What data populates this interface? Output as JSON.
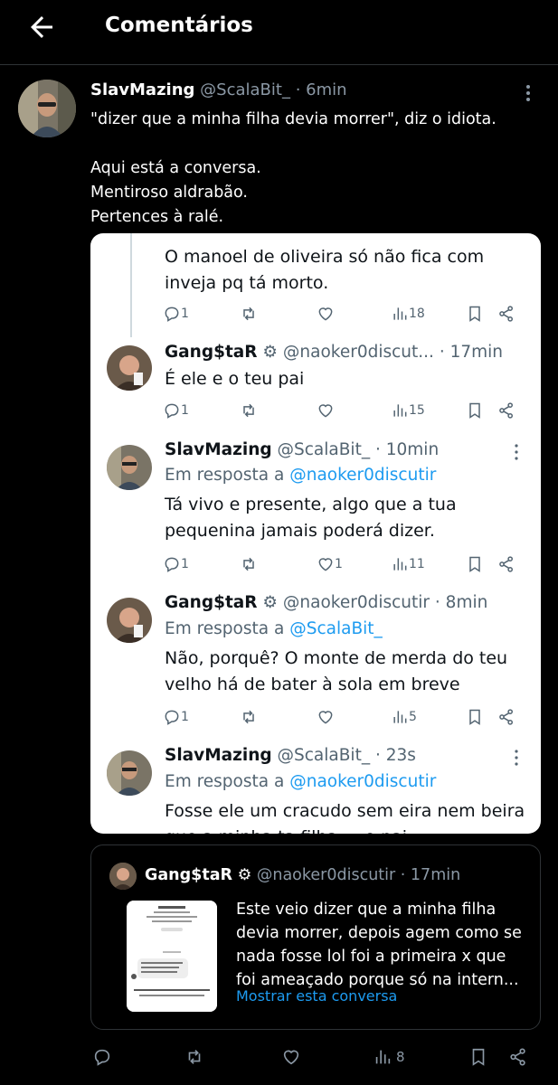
{
  "header": {
    "title": "Comentários"
  },
  "main_post": {
    "name": "SlavMazing",
    "handle": "@ScalaBit_",
    "time": "· 6min",
    "text_line1": "\"dizer que a minha filha devia morrer\", diz o idiota.",
    "text_line2": "Aqui está a conversa.",
    "text_line3": "Mentiroso aldrabão.",
    "text_line4": "Pertences à ralé.",
    "views": "8"
  },
  "screenshot": {
    "tweets": [
      {
        "text_line1": "O manoel de oliveira só não fica com",
        "text_line2": "inveja pq tá morto.",
        "replies": "1",
        "likes": "",
        "views": "18"
      },
      {
        "name": "Gang$taR",
        "handle": "@naoker0discut...",
        "time": "· 17min",
        "text_line1": "É ele e o teu pai",
        "replies": "1",
        "likes": "",
        "views": "15"
      },
      {
        "name": "SlavMazing",
        "handle": "@ScalaBit_",
        "time": "· 10min",
        "reply_prefix": "Em resposta a",
        "reply_to": "@naoker0discutir",
        "text_line1": "Tá vivo e presente, algo que a tua",
        "text_line2": "pequenina jamais poderá dizer.",
        "replies": "1",
        "likes": "1",
        "views": "11"
      },
      {
        "name": "Gang$taR",
        "handle": "@naoker0discutir",
        "time": "· 8min",
        "reply_prefix": "Em resposta a",
        "reply_to": "@ScalaBit_",
        "text_line1": "Não, porquê? O monte de merda do teu",
        "text_line2": "velho há de bater à sola em breve",
        "replies": "1",
        "likes": "",
        "views": "5"
      },
      {
        "name": "SlavMazing",
        "handle": "@ScalaBit_",
        "time": "· 23s",
        "reply_prefix": "Em resposta a",
        "reply_to": "@naoker0discutir",
        "text_line1": "Fosse ele um cracudo sem eira nem beira",
        "text_line2": "que a minha ta filha ... o pai ..."
      }
    ]
  },
  "quote": {
    "name": "Gang$taR",
    "handle": "@naoker0discutir",
    "time": "· 17min",
    "text_line1": "Este veio dizer que a minha filha",
    "text_line2": "devia morrer, depois agem como se",
    "text_line3": "nada fosse lol foi a primeira x que",
    "text_line4": "foi ameaçado porque só na intern...",
    "show_more": "Mostrar esta conversa"
  },
  "colors": {
    "background": "#000000",
    "accent": "#1d9bf0",
    "muted": "#8b98a5"
  }
}
